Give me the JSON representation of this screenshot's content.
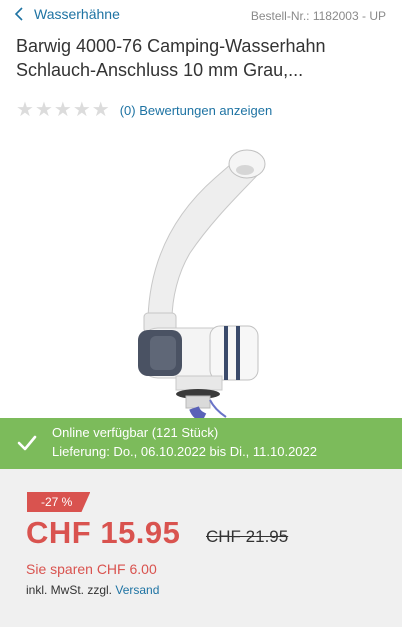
{
  "header": {
    "back_label": "Wasserhähne",
    "article_number": "Bestell-Nr.: 1182003 - UP"
  },
  "product": {
    "title_line1": "Barwig 4000-76 Camping-Wasserhahn",
    "title_line2": "Schlauch-Anschluss 10 mm Grau,...",
    "rating": {
      "stars": 0,
      "max_stars": 5,
      "link": "(0) Bewertungen anzeigen"
    }
  },
  "availability": {
    "status": "Online verfügbar (121 Stück)",
    "delivery": "Lieferung: Do., 06.10.2022 bis Di., 11.10.2022",
    "color": "#7cbb5b"
  },
  "pricing": {
    "discount": "-27 %",
    "price": "CHF 15.95",
    "old_price": "CHF 21.95",
    "savings": "Sie sparen CHF 6.00",
    "vat_prefix": "inkl. MwSt. zzgl.",
    "shipping_link": "Versand",
    "accent_color": "#d9534f"
  }
}
